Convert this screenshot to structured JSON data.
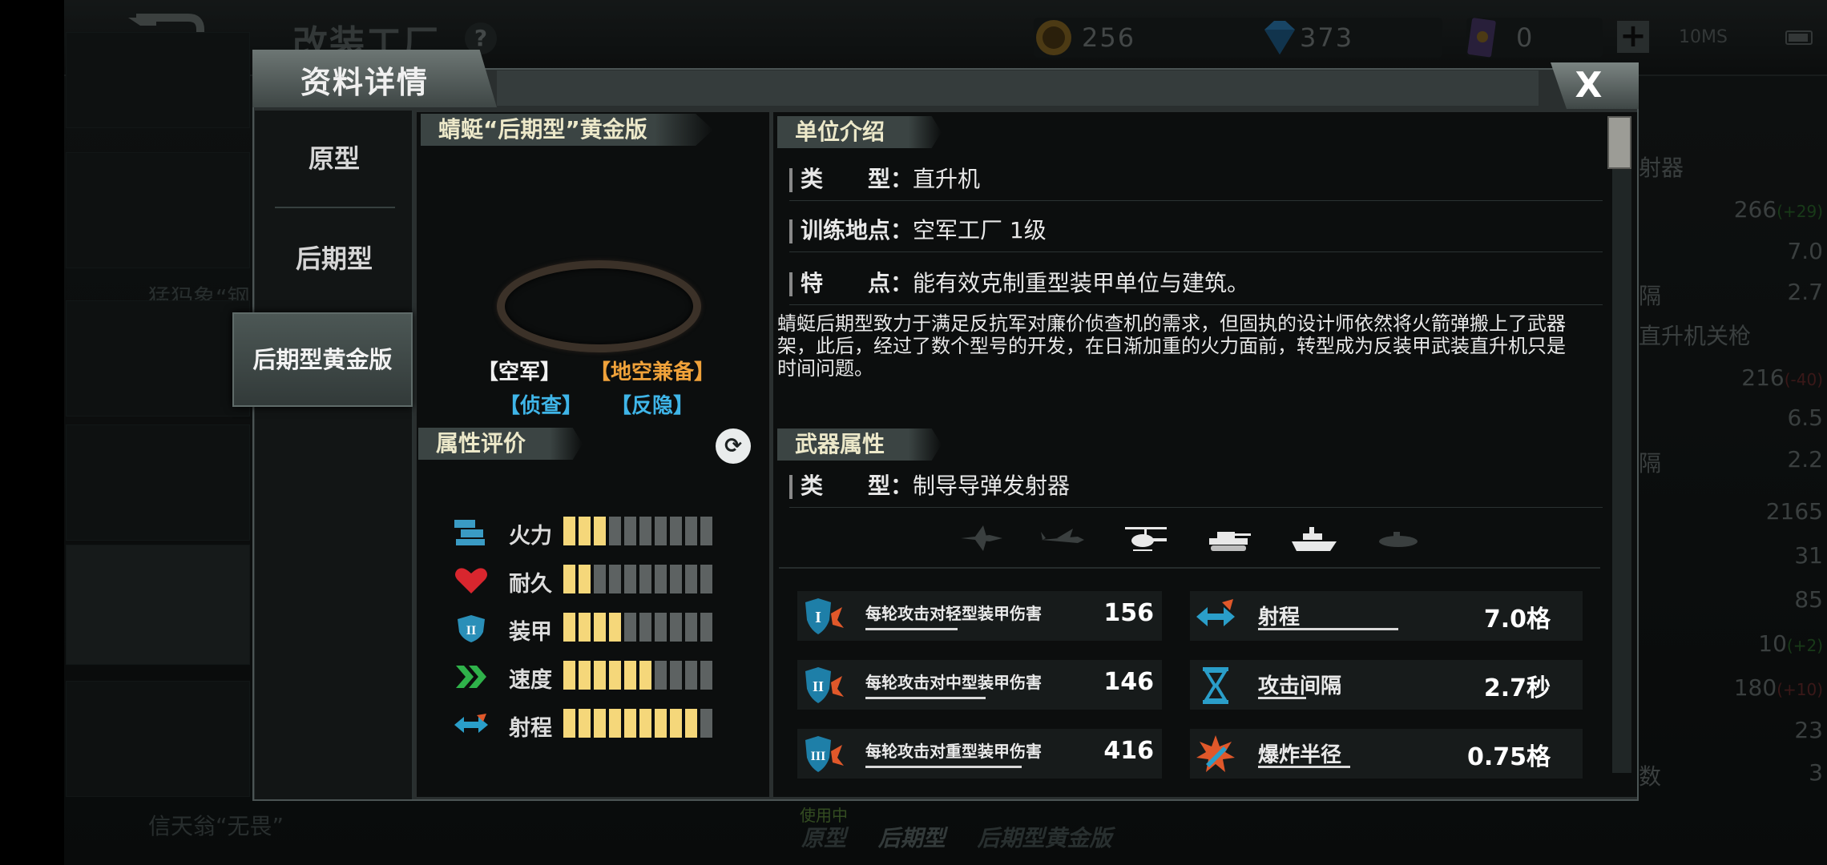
{
  "topbar": {
    "title": "改装工厂",
    "help": "?",
    "coins": "256",
    "gems": "373",
    "cards": "0",
    "plus": "+",
    "ping": "10MS"
  },
  "background": {
    "unit_labels": [
      "猛犸象“钢",
      "信天翁“无畏”"
    ],
    "right_title": "射器",
    "right_title2": "直升机关枪",
    "stats": [
      {
        "value": "266",
        "delta": "(+29)"
      },
      {
        "value": "7.0"
      },
      {
        "label": "隔",
        "value": "2.7"
      },
      {
        "value": "216",
        "delta": "(-40)"
      },
      {
        "value": "6.5"
      },
      {
        "label": "隔",
        "value": "2.2"
      },
      {
        "value": "2165"
      },
      {
        "value": "31"
      },
      {
        "value": "85"
      },
      {
        "value": "10",
        "delta": "(+2)"
      },
      {
        "value": "180",
        "delta": "(+10)"
      },
      {
        "value": "23"
      },
      {
        "label": "数",
        "value": "3"
      }
    ],
    "bottom_using": "使用中",
    "bottom_tabs": [
      "原型",
      "后期型",
      "后期型黄金版"
    ]
  },
  "dialog": {
    "title": "资料详情",
    "close": "X",
    "variants": [
      "原型",
      "后期型",
      "后期型黄金版"
    ],
    "unit_name": "蜻蜓“后期型”黄金版",
    "tags": [
      {
        "text": "【空军】",
        "color": "#f2f2f2"
      },
      {
        "text": "【地空兼备】",
        "color": "#f0a23a"
      },
      {
        "text": "【侦查】",
        "color": "#3fb5e8"
      },
      {
        "text": "【反隐】",
        "color": "#3fb5e8"
      }
    ],
    "attr_title": "属性评价",
    "attributes": [
      {
        "label": "火力",
        "icon": "firepower-icon",
        "value": 3,
        "max": 10
      },
      {
        "label": "耐久",
        "icon": "heart-icon",
        "value": 2,
        "max": 10
      },
      {
        "label": "装甲",
        "icon": "armor-shield-icon",
        "value": 4,
        "max": 10
      },
      {
        "label": "速度",
        "icon": "speed-chevrons-icon",
        "value": 6,
        "max": 10
      },
      {
        "label": "射程",
        "icon": "range-arrows-icon",
        "value": 9,
        "max": 10
      }
    ],
    "intro_title": "单位介绍",
    "info": [
      {
        "key": "类　　型：",
        "value": "直升机"
      },
      {
        "key": "训练地点：",
        "value": "空军工厂 1级"
      },
      {
        "key": "特　　点：",
        "value": "能有效克制重型装甲单位与建筑。"
      }
    ],
    "description": "蜻蜓后期型致力于满足反抗军对廉价侦查机的需求，但固执的设计师依然将火箭弹搬上了武器架，此后，经过了数个型号的开发，在日渐加重的火力面前，转型成为反装甲武装直升机只是时间问题。",
    "weapon_title": "武器属性",
    "weapon_type": {
      "key": "类　　型：",
      "value": "制导导弹发射器"
    },
    "targets": [
      "fighter-jet-icon",
      "bomber-jet-icon",
      "helicopter-icon",
      "tank-icon",
      "ship-icon",
      "submarine-icon"
    ],
    "damage": [
      {
        "label": "每轮攻击对轻型装甲伤害",
        "value": "156",
        "icon": "light-armor-icon"
      },
      {
        "label": "每轮攻击对中型装甲伤害",
        "value": "146",
        "icon": "medium-armor-icon"
      },
      {
        "label": "每轮攻击对重型装甲伤害",
        "value": "416",
        "icon": "heavy-armor-icon"
      }
    ],
    "specs": [
      {
        "label": "射程",
        "value": "7.0格",
        "icon": "range-icon"
      },
      {
        "label": "攻击间隔",
        "value": "2.7秒",
        "icon": "hourglass-icon"
      },
      {
        "label": "爆炸半径",
        "value": "0.75格",
        "icon": "explosion-icon"
      }
    ]
  },
  "colors": {
    "accent_gold": "#f5d77a",
    "tag_orange": "#f0a23a",
    "tag_blue": "#3fb5e8"
  }
}
